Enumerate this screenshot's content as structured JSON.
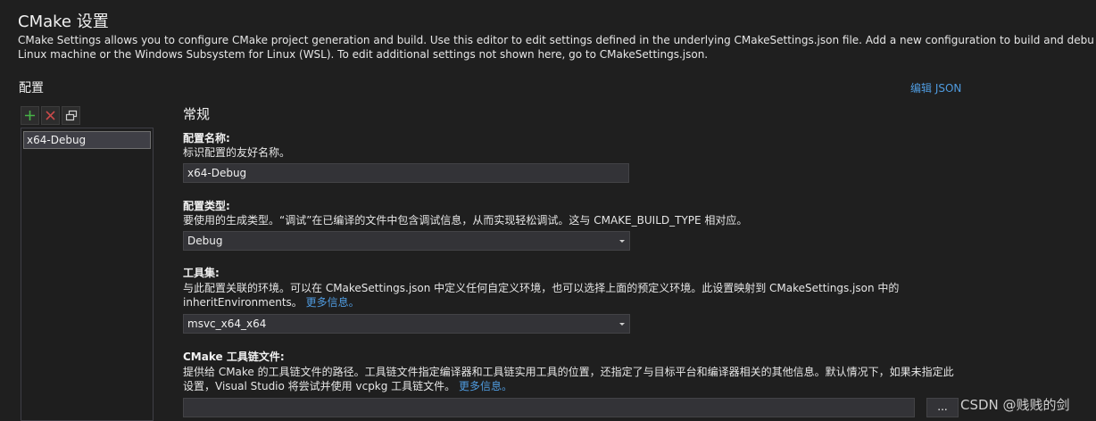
{
  "header": {
    "title": "CMake 设置",
    "intro_line1": "CMake Settings allows you to configure CMake project generation and build. Use this editor to edit settings defined in the underlying CMakeSettings.json file. Add a new configuration to build and debug on",
    "intro_line2": "Linux machine or the Windows Subsystem for Linux (WSL). To edit additional settings not shown here, go to CMakeSettings.json."
  },
  "sidebar": {
    "title": "配置",
    "toolbar": [
      {
        "name": "add-config",
        "icon": "plus-icon",
        "color": "#47b347"
      },
      {
        "name": "remove-config",
        "icon": "close-icon",
        "color": "#c94a4a"
      },
      {
        "name": "copy-config",
        "icon": "copy-icon",
        "color": "#cfcfcf"
      }
    ],
    "items": [
      "x64-Debug"
    ]
  },
  "edit_json_label": "编辑 JSON",
  "section_title": "常规",
  "fields": {
    "config_name": {
      "label": "配置名称:",
      "description": "标识配置的友好名称。",
      "value": "x64-Debug"
    },
    "config_type": {
      "label": "配置类型:",
      "description": "要使用的生成类型。“调试”在已编译的文件中包含调试信息，从而实现轻松调试。这与 CMAKE_BUILD_TYPE 相对应。",
      "value": "Debug"
    },
    "toolset": {
      "label": "工具集:",
      "description_line1": "与此配置关联的环境。可以在 CMakeSettings.json 中定义任何自定义环境，也可以选择上面的预定义环境。此设置映射到 CMakeSettings.json 中的",
      "description_line2": "inheritEnvironments。",
      "more_link": "更多信息。",
      "value": "msvc_x64_x64"
    },
    "toolchain_file": {
      "label": "CMake 工具链文件:",
      "description_line1": "提供给 CMake 的工具链文件的路径。工具链文件指定编译器和工具链实用工具的位置，还指定了与目标平台和编译器相关的其他信息。默认情况下，如果未指定此",
      "description_line2": "设置，Visual Studio 将尝试并使用 vcpkg 工具链文件。",
      "more_link": "更多信息。",
      "value": "",
      "browse_label": "..."
    }
  },
  "watermark": "CSDN @贱贱的剑",
  "colors": {
    "background": "#1f1f1f",
    "link": "#4f9bdf",
    "input_bg": "#333337"
  }
}
